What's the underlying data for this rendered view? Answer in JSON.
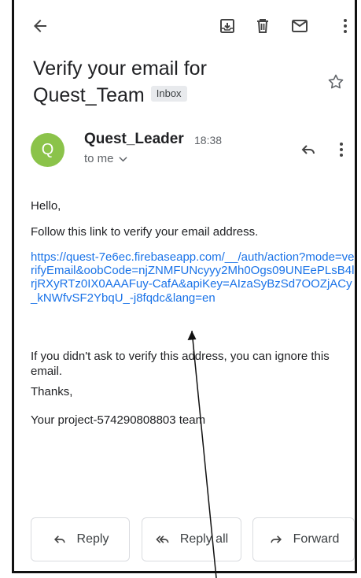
{
  "email": {
    "subject": "Verify your email for Quest_Team",
    "label": "Inbox",
    "avatar_letter": "Q",
    "sender": "Quest_Leader",
    "time": "18:38",
    "recipient": "to me",
    "body": {
      "greeting": "Hello,",
      "instruction": "Follow this link to verify your email address.",
      "link": "https://quest-7e6ec.firebaseapp.com/__/auth/action?mode=verifyEmail&oobCode=njZNMFUNcyyy2Mh0Ogs09UNEePLsB4lrjRXyRTz0IX0AAAFuy-CafA&apiKey=AIzaSyBzSd7OOZjACy_kNWfvSF2YbqU_-j8fqdc&lang=en",
      "ignore_note": "If you didn't ask to verify this address, you can ignore this email.",
      "thanks": "Thanks,",
      "signature": "Your project-574290808803 team"
    }
  },
  "actions": {
    "reply": "Reply",
    "reply_all": "Reply all",
    "forward": "Forward"
  },
  "colors": {
    "link": "#1a73e8",
    "avatar": "#8bc34a"
  },
  "icons": [
    "back-arrow-icon",
    "archive-icon",
    "delete-icon",
    "mail-icon",
    "more-vert-icon",
    "star-icon",
    "reply-icon",
    "reply-all-icon",
    "forward-icon",
    "chevron-down-icon"
  ]
}
